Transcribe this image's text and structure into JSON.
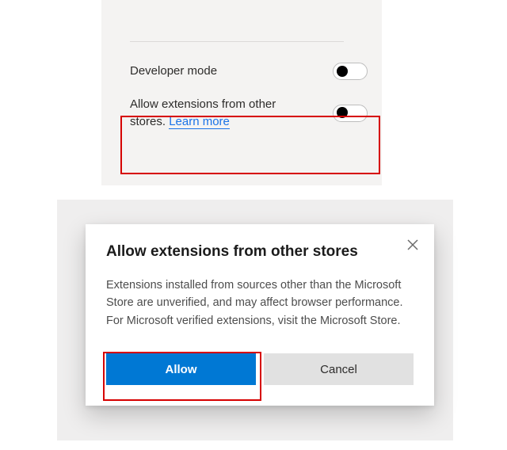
{
  "settings": {
    "items": [
      {
        "label": "Developer mode",
        "toggled": false
      },
      {
        "label_prefix": "Allow extensions from other stores. ",
        "learn_more": "Learn more",
        "toggled": false
      }
    ]
  },
  "dialog": {
    "title": "Allow extensions from other stores",
    "body": "Extensions installed from sources other than the Microsoft Store are unverified, and may affect browser performance. For Microsoft verified extensions, visit the Microsoft Store.",
    "primary_button": "Allow",
    "secondary_button": "Cancel"
  }
}
